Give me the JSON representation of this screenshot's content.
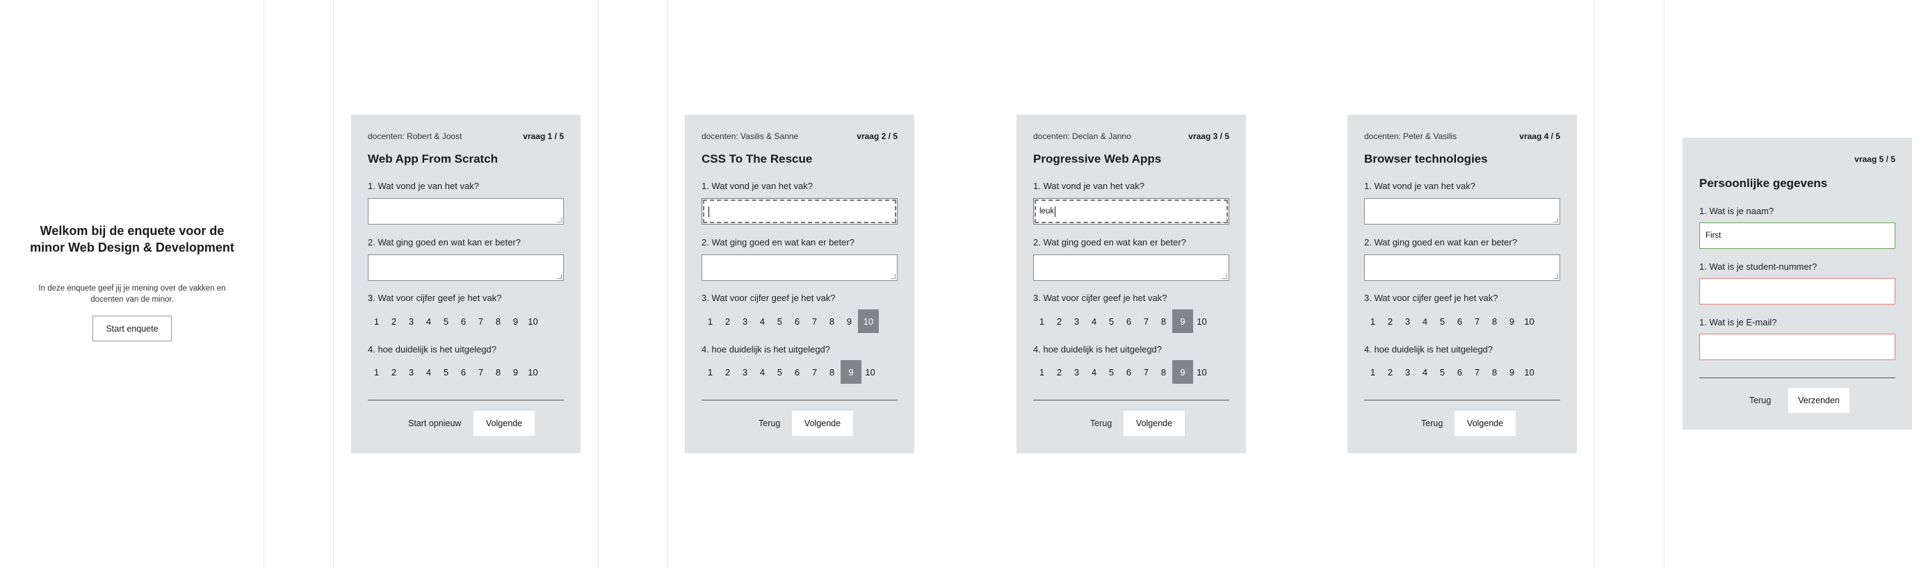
{
  "welcome": {
    "title": "Welkom bij de enquete voor de minor Web Design & Development",
    "intro": "In deze enquete geef jij je mening over de vakken en docenten van de minor.",
    "start_label": "Start enquete"
  },
  "questions": {
    "q1": "1. Wat vond je van het vak?",
    "q2": "2. Wat ging goed en wat kan er beter?",
    "q3": "3. Wat voor cijfer geef je het vak?",
    "q4": "4. hoe duidelijk is het uitgelegd?"
  },
  "scale": [
    "1",
    "2",
    "3",
    "4",
    "5",
    "6",
    "7",
    "8",
    "9",
    "10"
  ],
  "cards": [
    {
      "docenten": "docenten: Robert & Joost",
      "step": "vraag 1 / 5",
      "title": "Web App From Scratch",
      "answer1": "",
      "answer2": "",
      "grade": null,
      "clarity": null,
      "back_label": "Start opnieuw",
      "next_label": "Volgende"
    },
    {
      "docenten": "docenten: Vasilis & Sanne",
      "step": "vraag 2 / 5",
      "title": "CSS To The Rescue",
      "answer1": "",
      "answer2": "",
      "grade": 10,
      "clarity": 9,
      "back_label": "Terug",
      "next_label": "Volgende"
    },
    {
      "docenten": "docenten: Declan & Janno",
      "step": "vraag 3 / 5",
      "title": "Progressive Web Apps",
      "answer1": "leuk",
      "answer2": "",
      "grade": 9,
      "clarity": 9,
      "back_label": "Terug",
      "next_label": "Volgende"
    },
    {
      "docenten": "docenten: Peter & Vasilis",
      "step": "vraag 4 / 5",
      "title": "Browser technologies",
      "answer1": "",
      "answer2": "",
      "grade": null,
      "clarity": null,
      "back_label": "Terug",
      "next_label": "Volgende"
    }
  ],
  "personal": {
    "step": "vraag 5 / 5",
    "title": "Persoonlijke gegevens",
    "name_label": "1. Wat is je naam?",
    "name_value": "First",
    "student_label": "1. Wat is je student-nummer?",
    "student_value": "",
    "email_label": "1. Wat is je E-mail?",
    "email_value": "",
    "back_label": "Terug",
    "submit_label": "Verzenden"
  },
  "colors": {
    "card_bg": "#dfe3e6",
    "selected": "#808589",
    "valid": "#69a35e",
    "invalid": "#e0807f"
  }
}
